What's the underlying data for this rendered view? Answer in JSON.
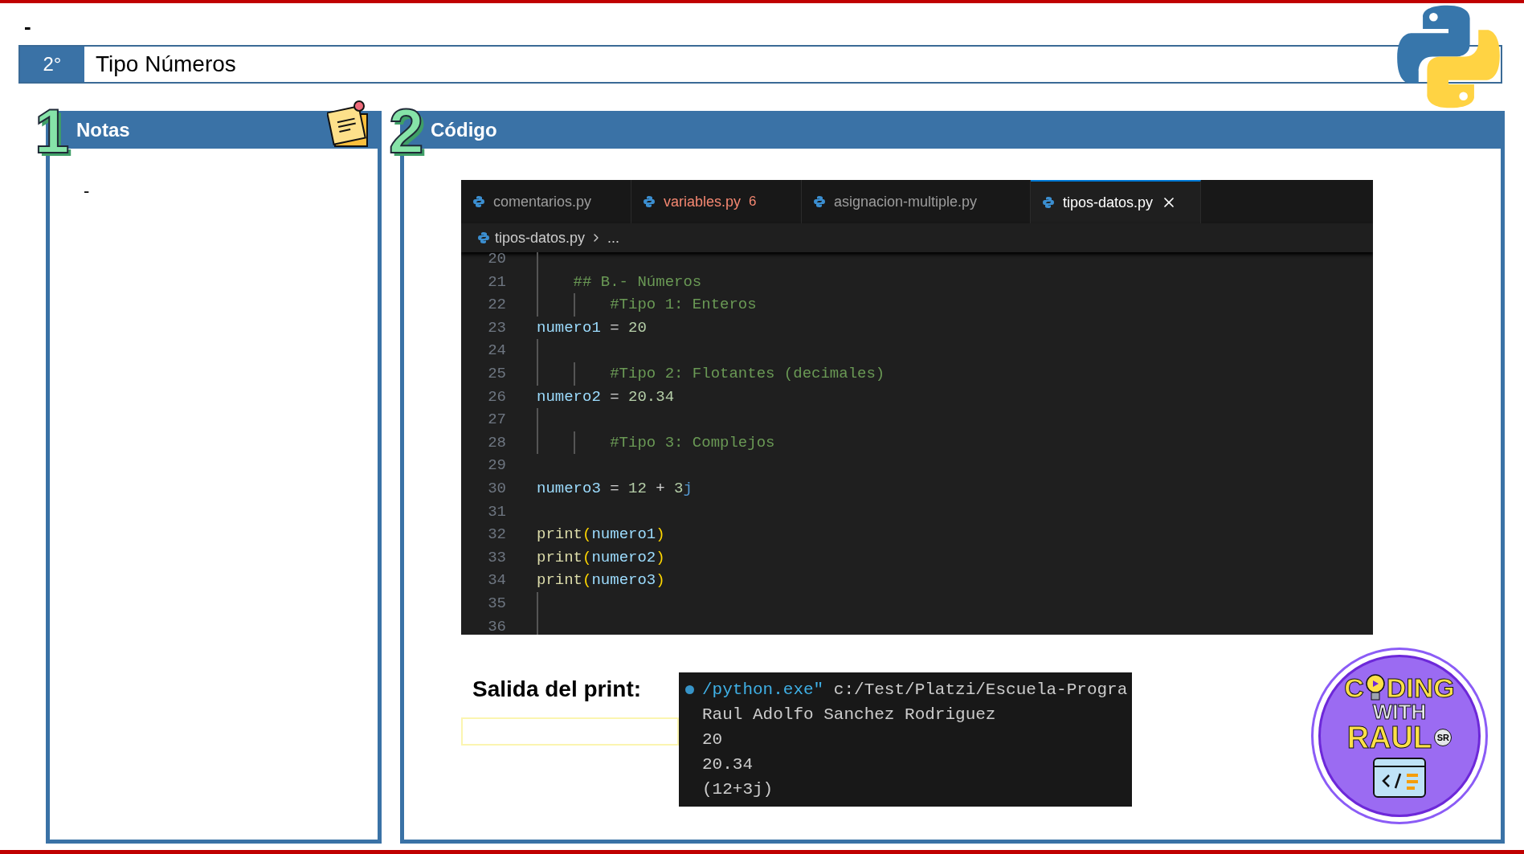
{
  "top_note": "-",
  "topic": {
    "number": "2°",
    "title": "Tipo Números"
  },
  "notes": {
    "numeral": "1",
    "title": "Notas",
    "body": "-"
  },
  "code_panel": {
    "numeral": "2",
    "title": "Código",
    "editor": {
      "tabs": [
        {
          "label": "comentarios.py",
          "selected": false,
          "error": false
        },
        {
          "label": "variables.py",
          "selected": false,
          "error": true,
          "problems": "6"
        },
        {
          "label": "asignacion-multiple.py",
          "selected": false,
          "error": false
        },
        {
          "label": "tipos-datos.py",
          "selected": true,
          "error": false
        }
      ],
      "breadcrumb": [
        "tipos-datos.py",
        "..."
      ],
      "lines": [
        {
          "number": "20",
          "guide": true
        },
        {
          "number": "21",
          "guide": true,
          "tokens": [
            {
              "kind": "comment",
              "text": "    ## B.- Números"
            }
          ]
        },
        {
          "number": "22",
          "guide": true,
          "tokens": [
            {
              "kind": "comment",
              "text": "        #Tipo 1: Enteros"
            }
          ]
        },
        {
          "number": "23",
          "guide": false,
          "tokens": [
            {
              "kind": "var",
              "text": "numero1"
            },
            {
              "kind": "op",
              "text": " = "
            },
            {
              "kind": "num",
              "text": "20"
            }
          ]
        },
        {
          "number": "24",
          "guide": true
        },
        {
          "number": "25",
          "guide": true,
          "tokens": [
            {
              "kind": "comment",
              "text": "        #Tipo 2: Flotantes (decimales)"
            }
          ]
        },
        {
          "number": "26",
          "guide": false,
          "tokens": [
            {
              "kind": "var",
              "text": "numero2"
            },
            {
              "kind": "op",
              "text": " = "
            },
            {
              "kind": "num",
              "text": "20.34"
            }
          ]
        },
        {
          "number": "27",
          "guide": true
        },
        {
          "number": "28",
          "guide": true,
          "tokens": [
            {
              "kind": "comment",
              "text": "        #Tipo 3: Complejos"
            }
          ]
        },
        {
          "number": "29",
          "guide": false
        },
        {
          "number": "30",
          "guide": false,
          "tokens": [
            {
              "kind": "var",
              "text": "numero3"
            },
            {
              "kind": "op",
              "text": " = "
            },
            {
              "kind": "num",
              "text": "12"
            },
            {
              "kind": "op",
              "text": " + "
            },
            {
              "kind": "num",
              "text": "3"
            },
            {
              "kind": "kw",
              "text": "j"
            }
          ]
        },
        {
          "number": "31",
          "guide": false
        },
        {
          "number": "32",
          "guide": false,
          "tokens": [
            {
              "kind": "fn",
              "text": "print"
            },
            {
              "kind": "paren",
              "text": "("
            },
            {
              "kind": "var",
              "text": "numero1"
            },
            {
              "kind": "paren",
              "text": ")"
            }
          ]
        },
        {
          "number": "33",
          "guide": false,
          "tokens": [
            {
              "kind": "fn",
              "text": "print"
            },
            {
              "kind": "paren",
              "text": "("
            },
            {
              "kind": "var",
              "text": "numero2"
            },
            {
              "kind": "paren",
              "text": ")"
            }
          ]
        },
        {
          "number": "34",
          "guide": false,
          "tokens": [
            {
              "kind": "fn",
              "text": "print"
            },
            {
              "kind": "paren",
              "text": "("
            },
            {
              "kind": "var",
              "text": "numero3"
            },
            {
              "kind": "paren",
              "text": ")"
            }
          ]
        },
        {
          "number": "35",
          "guide": true
        },
        {
          "number": "36",
          "guide": true
        }
      ]
    },
    "output_label": "Salida del print:",
    "terminal": {
      "command_highlight": "/python.exe\"",
      "command_rest": " c:/Test/Platzi/Escuela-Progra",
      "lines": [
        "Raul Adolfo Sanchez Rodriguez",
        "20",
        "20.34",
        "(12+3j)"
      ]
    },
    "logo": {
      "first": "C",
      "first_rest": "DING",
      "middle": "WITH",
      "last": "RAUL",
      "badge": "SR"
    }
  }
}
